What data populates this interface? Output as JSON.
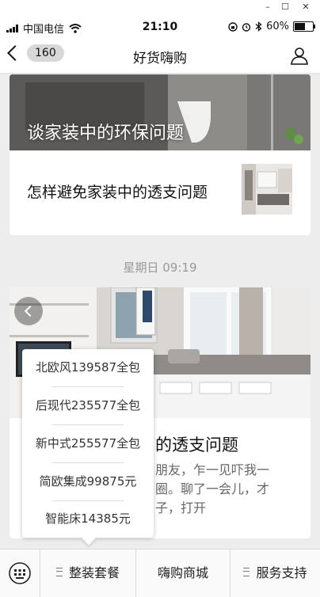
{
  "window": {
    "controls": [
      "–",
      "☐",
      "✕"
    ]
  },
  "status_bar": {
    "carrier": "中国电信",
    "time": "21:10",
    "battery": "60%",
    "battery_level": 0.6
  },
  "nav": {
    "unread": "160",
    "title": "好货嗨购"
  },
  "card1": {
    "hero_title": "谈家装中的环保问题",
    "item_title": "怎样避免家装中的透支问题"
  },
  "timestamp": "星期日 09:19",
  "card2": {
    "headline_partial": "的透支问题",
    "text_lines": [
      "朋友，乍一见吓我一",
      "圈。聊了一会儿，才",
      "子，打开"
    ]
  },
  "popup": {
    "items": [
      "北欧风139587全包",
      "后现代235577全包",
      "新中式255577全包",
      "简欧集成99875元",
      "智能床14385元"
    ]
  },
  "bottom_menu": {
    "items": [
      "整装套餐",
      "嗨购商城",
      "服务支持"
    ]
  }
}
